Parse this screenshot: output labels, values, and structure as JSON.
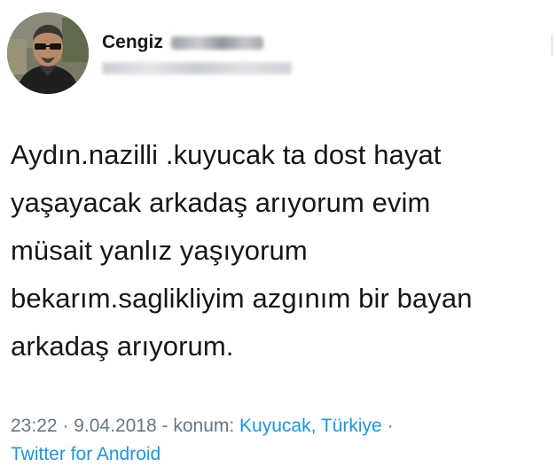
{
  "author": {
    "display_name": "Cengiz"
  },
  "tweet": {
    "lines": [
      "Aydın.nazilli .kuyucak ta dost hayat",
      "yaşayacak arkadaş arıyorum evim",
      "müsait yanlız yaşıyorum",
      "bekarım.saglikliyim azgınım bir bayan",
      "arkadaş arıyorum."
    ]
  },
  "meta": {
    "time": "23:22",
    "sep1": " · ",
    "date": "9.04.2018",
    "location_prefix": " - konum: ",
    "location": "Kuyucak, Türkiye",
    "sep2": " ·",
    "source": "Twitter for Android"
  },
  "colors": {
    "text": "#14171a",
    "muted": "#657786",
    "link": "#1b95e0"
  }
}
